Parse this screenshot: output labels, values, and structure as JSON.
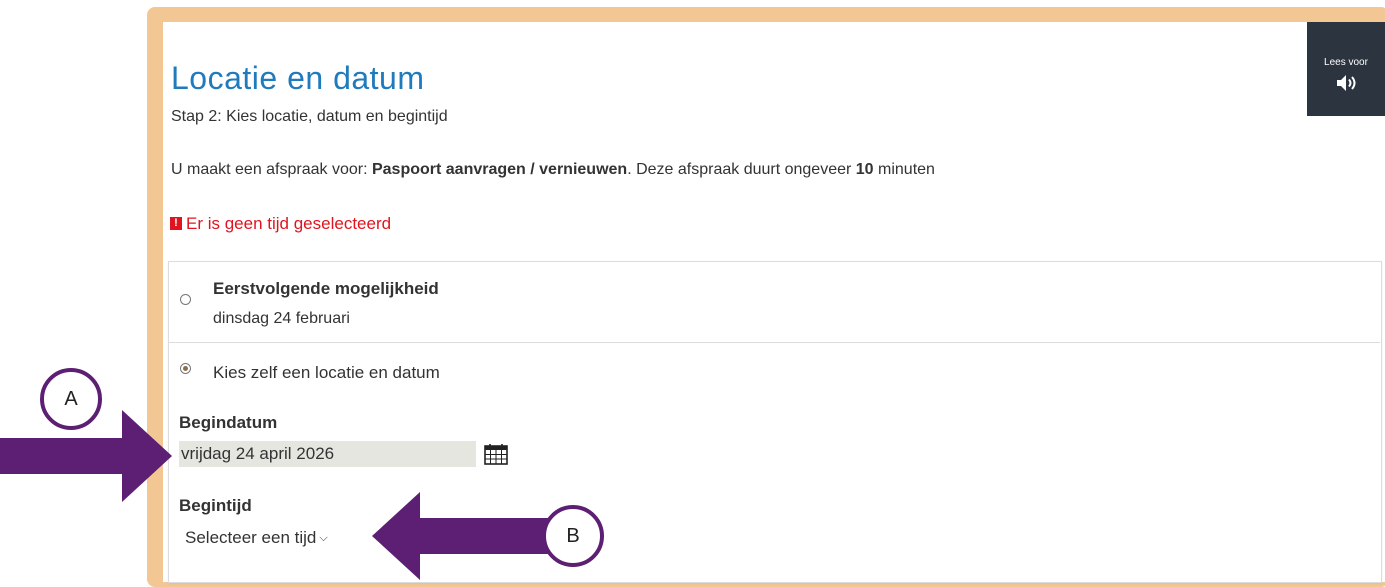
{
  "colors": {
    "frame": "#f3c794",
    "title": "#1f7bbd",
    "error": "#e0141e",
    "annotation": "#5d1f73",
    "lees_voor_bg": "#2c3440"
  },
  "lees_voor": {
    "label": "Lees voor",
    "icon": "speaker-icon"
  },
  "header": {
    "title": "Locatie en datum",
    "subtitle": "Stap 2: Kies locatie, datum en begintijd"
  },
  "info": {
    "prefix": "U maakt een afspraak voor: ",
    "product": "Paspoort aanvragen / vernieuwen",
    "middle": ". Deze afspraak duurt ongeveer ",
    "duration": "10",
    "suffix": " minuten"
  },
  "error": {
    "icon_text": "!",
    "message": "Er is geen tijd geselecteerd"
  },
  "options": {
    "first": {
      "title": "Eerstvolgende mogelijkheid",
      "date": "dinsdag 24 februari",
      "selected": false
    },
    "second": {
      "label": "Kies zelf een locatie en datum",
      "selected": true
    }
  },
  "begindatum": {
    "label": "Begindatum",
    "value": "vrijdag 24 april 2026",
    "icon": "calendar-icon"
  },
  "begintijd": {
    "label": "Begintijd",
    "value": "Selecteer een tijd",
    "icon": "chevron-down-icon"
  },
  "annotations": {
    "a": "A",
    "b": "B"
  }
}
